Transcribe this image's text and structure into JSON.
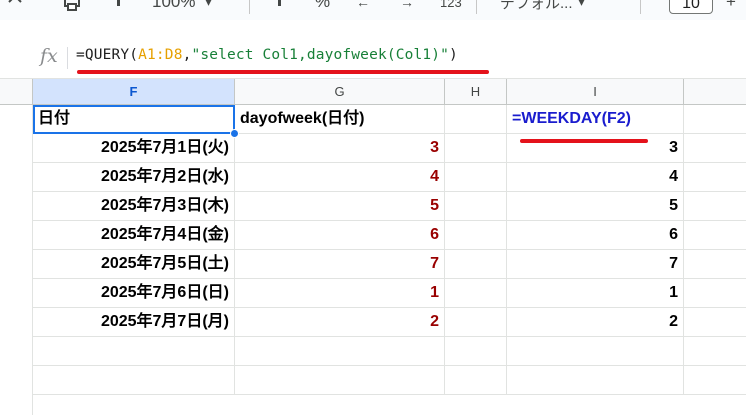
{
  "toolbar": {
    "zoom": "100%",
    "percent": "%",
    "decimals": ".00",
    "number_format": "123",
    "font_name": "デフォル...",
    "font_size": "10",
    "plus": "+"
  },
  "formula_bar": {
    "fx_label": "fx",
    "parts": {
      "p1": "=QUERY(",
      "p2": "A1:D8",
      "p3": ",",
      "p4": "\"select Col1,dayofweek(Col1)\"",
      "p5": ")"
    }
  },
  "columns": [
    "F",
    "G",
    "H",
    "I"
  ],
  "headers": {
    "f1": "日付",
    "g1": "dayofweek(日付)",
    "i1": "=WEEKDAY(F2)"
  },
  "rows": [
    {
      "date": "2025年7月1日(火)",
      "dow": "3",
      "weekday": "3"
    },
    {
      "date": "2025年7月2日(水)",
      "dow": "4",
      "weekday": "4"
    },
    {
      "date": "2025年7月3日(木)",
      "dow": "5",
      "weekday": "5"
    },
    {
      "date": "2025年7月4日(金)",
      "dow": "6",
      "weekday": "6"
    },
    {
      "date": "2025年7月5日(土)",
      "dow": "7",
      "weekday": "7"
    },
    {
      "date": "2025年7月6日(日)",
      "dow": "1",
      "weekday": "1"
    },
    {
      "date": "2025年7月7日(月)",
      "dow": "2",
      "weekday": "2"
    }
  ],
  "colors": {
    "accent_red": "#e4121b",
    "value_dark_red": "#990000",
    "formula_blue": "#1a1cce",
    "selection_blue": "#1a73e8"
  }
}
